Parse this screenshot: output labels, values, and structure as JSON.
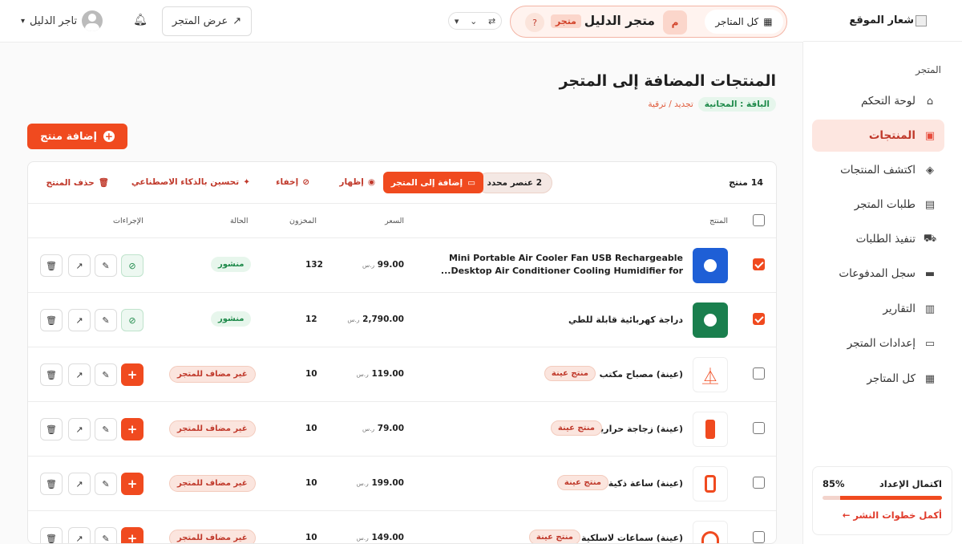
{
  "sidebar": {
    "logo_alt": "شعار الموقع",
    "section": "المتجر",
    "items": [
      {
        "label": "لوحة التحكم",
        "icon": "home-icon"
      },
      {
        "label": "المنتجات",
        "icon": "box-icon",
        "active": true
      },
      {
        "label": "اكتشف المنتجات",
        "icon": "compass-icon"
      },
      {
        "label": "طلبات المتجر",
        "icon": "receipt-icon"
      },
      {
        "label": "تنفيذ الطلبات",
        "icon": "truck-icon"
      },
      {
        "label": "سجل المدفوعات",
        "icon": "money-icon"
      },
      {
        "label": "التقارير",
        "icon": "chart-icon"
      },
      {
        "label": "إعدادات المتجر",
        "icon": "store-icon"
      },
      {
        "label": "كل المتاجر",
        "icon": "grid-icon"
      }
    ],
    "setup": {
      "title": "اكتمال الإعداد",
      "percent_label": "85%",
      "progress": 0.85,
      "link": "أكمل خطوات النشر ←"
    }
  },
  "topbar": {
    "all_stores": "كل المتاجر",
    "store_initial": "م",
    "store_name": "متجر الدليل",
    "store_badge": "متجر",
    "help": "?",
    "view_store": "عرض المتجر",
    "user_name": "تاجر الدليل"
  },
  "page": {
    "title": "المنتجات المضافة إلى المتجر",
    "plan_badge": "الباقة : المجانية",
    "plan_link": "تجديد / ترقية",
    "add_product": "إضافة منتج"
  },
  "table": {
    "count": "14 منتج",
    "selected": "2 عنصر محدد",
    "actions": {
      "add_to_store": "إضافة إلى المتجر",
      "show": "إظهار",
      "hide": "إخفاء",
      "ai": "تحسين بالذكاء الاصطناعي",
      "delete": "حذف المنتج"
    },
    "headers": {
      "product": "المنتج",
      "price": "السعر",
      "stock": "المخزون",
      "status": "الحالة",
      "actions": "الإجراءات"
    },
    "currency": "ر.س",
    "sample_tag": "منتج عينة",
    "rows": [
      {
        "name1": "Mini Portable Air Cooler Fan USB Rechargeable",
        "name2": "Desktop Air Conditioner Cooling Humidifier for...",
        "price": "99.00",
        "stock": "132",
        "status": "منشور",
        "checked": true,
        "image": "fan-image",
        "color": "#1e5fd6"
      },
      {
        "name1": "دراجة كهربائية قابلة للطي",
        "price": "2,790.00",
        "stock": "12",
        "status": "منشور",
        "checked": true,
        "image": "bike-image",
        "color": "#1a7f4e"
      },
      {
        "name1": "(عينة) مصباح مكتب",
        "price": "119.00",
        "stock": "10",
        "status": "غير مضاف للمتجر",
        "checked": false,
        "image": "lamp-image",
        "color": "#f04a1f"
      },
      {
        "name1": "(عينة) زجاجة حرارية",
        "price": "79.00",
        "stock": "10",
        "status": "غير مضاف للمتجر",
        "checked": false,
        "image": "bottle-image",
        "color": "#f04a1f"
      },
      {
        "name1": "(عينة) ساعة ذكية",
        "price": "199.00",
        "stock": "10",
        "status": "غير مضاف للمتجر",
        "checked": false,
        "image": "watch-image",
        "color": "#f04a1f"
      },
      {
        "name1": "(عينة) سماعات لاسلكية",
        "price": "149.00",
        "stock": "10",
        "status": "غير مضاف للمتجر",
        "checked": false,
        "image": "headphones-image",
        "color": "#f04a1f"
      }
    ]
  }
}
